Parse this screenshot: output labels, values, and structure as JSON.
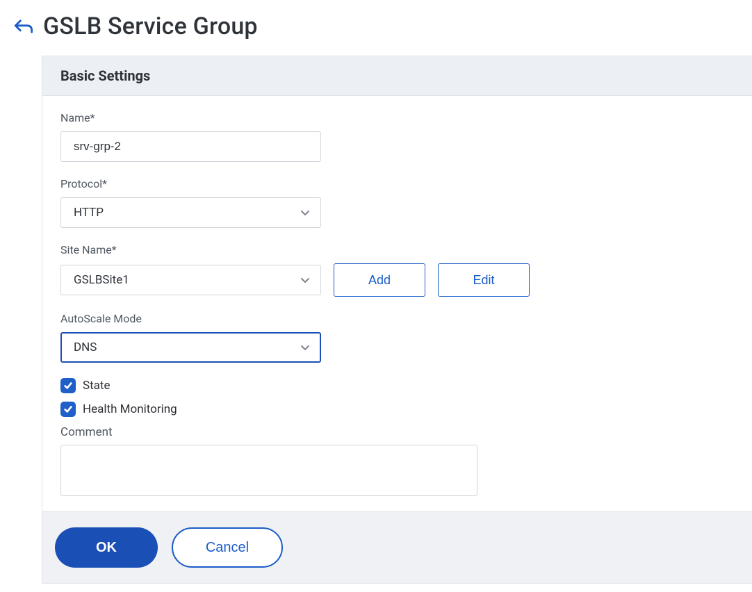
{
  "header": {
    "title": "GSLB Service Group"
  },
  "panel": {
    "title": "Basic Settings"
  },
  "fields": {
    "name": {
      "label": "Name*",
      "value": "srv-grp-2"
    },
    "protocol": {
      "label": "Protocol*",
      "value": "HTTP"
    },
    "siteName": {
      "label": "Site Name*",
      "value": "GSLBSite1"
    },
    "autoscale": {
      "label": "AutoScale Mode",
      "value": "DNS"
    },
    "state": {
      "label": "State",
      "checked": true
    },
    "healthMonitoring": {
      "label": "Health Monitoring",
      "checked": true
    },
    "comment": {
      "label": "Comment",
      "value": ""
    }
  },
  "buttons": {
    "add": "Add",
    "edit": "Edit",
    "ok": "OK",
    "cancel": "Cancel"
  }
}
